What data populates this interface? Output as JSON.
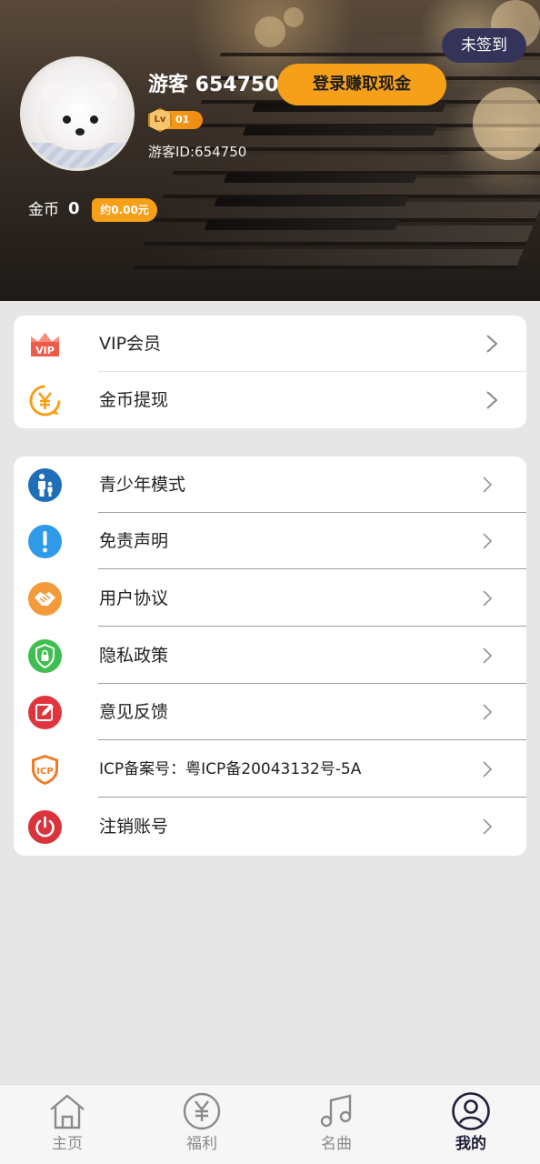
{
  "header": {
    "signin_status": "未签到",
    "username": "游客 654750",
    "login_button": "登录赚取现金",
    "level_prefix": "Lv",
    "level": "01",
    "visitor_id": "游客ID:654750",
    "coins_label": "金币",
    "coins_value": "0",
    "coins_approx": "约0.00元"
  },
  "card1": [
    {
      "label": "VIP会员",
      "icon": "vip-crown-icon"
    },
    {
      "label": "金币提现",
      "icon": "yuan-coin-icon"
    }
  ],
  "card2": [
    {
      "label": "青少年模式",
      "icon": "parent-child-icon"
    },
    {
      "label": "免责声明",
      "icon": "exclamation-icon"
    },
    {
      "label": "用户协议",
      "icon": "handshake-icon"
    },
    {
      "label": "隐私政策",
      "icon": "shield-lock-icon"
    },
    {
      "label": "意见反馈",
      "icon": "edit-icon"
    },
    {
      "label": "ICP备案号：粤ICP备20043132号-5A",
      "icon": "icp-shield-icon"
    },
    {
      "label": "注销账号",
      "icon": "power-icon"
    }
  ],
  "nav": [
    {
      "label": "主页",
      "icon": "home-icon",
      "active": false
    },
    {
      "label": "福利",
      "icon": "yuan-circle-icon",
      "active": false
    },
    {
      "label": "名曲",
      "icon": "music-note-icon",
      "active": false
    },
    {
      "label": "我的",
      "icon": "user-icon",
      "active": true
    }
  ],
  "colors": {
    "accent": "#f6a01a",
    "badge_bg": "#34345a",
    "nav_active": "#1f1f3a",
    "nav_inactive": "#8a8a8a"
  }
}
